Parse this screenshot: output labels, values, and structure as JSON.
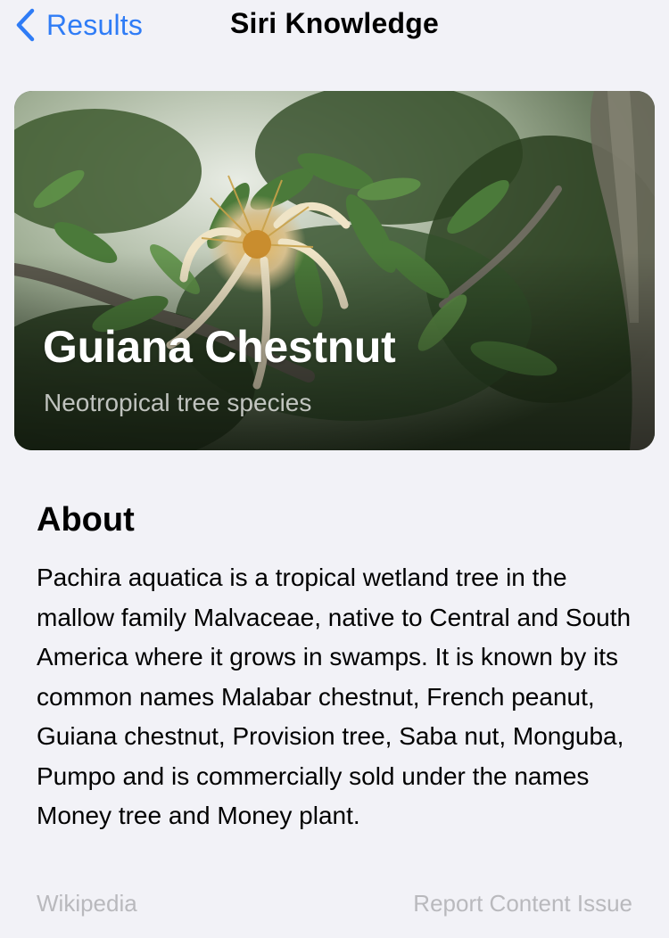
{
  "navbar": {
    "back_label": "Results",
    "title": "Siri Knowledge"
  },
  "hero": {
    "title": "Guiana Chestnut",
    "subtitle": "Neotropical tree species",
    "image_subject": "Pachira aquatica flower among green leaves"
  },
  "about": {
    "heading": "About",
    "body": "Pachira aquatica is a tropical wetland tree in the mallow family Malvaceae, native to Central and South America where it grows in swamps. It is known by its common names Malabar chestnut, French peanut, Guiana chestnut, Provision tree, Saba nut, Monguba, Pumpo and is commercially sold under the names Money tree and Money plant."
  },
  "footer": {
    "source_label": "Wikipedia",
    "report_label": "Report Content Issue"
  },
  "colors": {
    "accent": "#2f7cf6",
    "background": "#f2f2f7",
    "muted_text": "#b9b9bd"
  },
  "icons": {
    "back": "chevron-left-icon"
  }
}
